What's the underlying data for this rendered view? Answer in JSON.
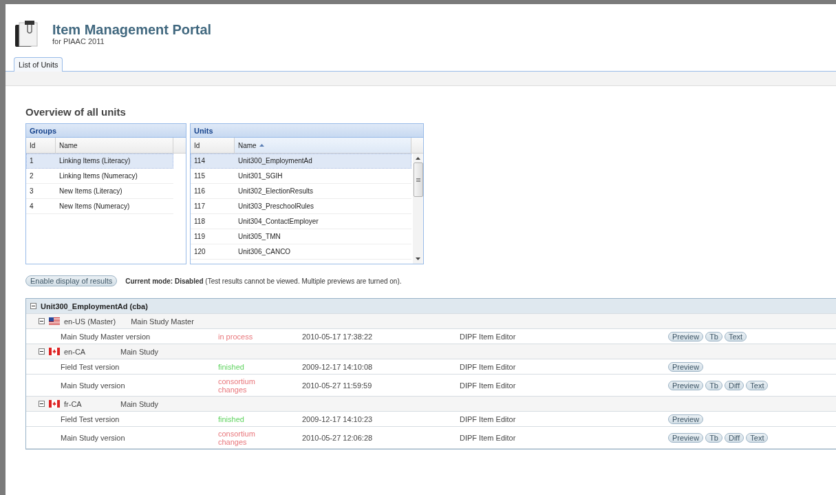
{
  "header": {
    "title": "Item Management Portal",
    "subtitle": "for PIAAC 2011"
  },
  "tabs": [
    {
      "label": "List of Units",
      "selected": true
    }
  ],
  "heading": "Overview of all units",
  "groups": {
    "title": "Groups",
    "columns": [
      "Id",
      "Name"
    ],
    "rows": [
      {
        "id": "1",
        "name": "Linking Items (Literacy)",
        "selected": true
      },
      {
        "id": "2",
        "name": "Linking Items (Numeracy)",
        "selected": false
      },
      {
        "id": "3",
        "name": "New Items (Literacy)",
        "selected": false
      },
      {
        "id": "4",
        "name": "New Items (Numeracy)",
        "selected": false
      }
    ]
  },
  "units": {
    "title": "Units",
    "columns": [
      {
        "label": "Id",
        "sorted": false
      },
      {
        "label": "Name",
        "sorted": true
      }
    ],
    "rows": [
      {
        "id": "114",
        "name": "Unit300_EmploymentAd",
        "selected": true
      },
      {
        "id": "115",
        "name": "Unit301_SGIH",
        "selected": false
      },
      {
        "id": "116",
        "name": "Unit302_ElectionResults",
        "selected": false
      },
      {
        "id": "117",
        "name": "Unit303_PreschoolRules",
        "selected": false
      },
      {
        "id": "118",
        "name": "Unit304_ContactEmployer",
        "selected": false
      },
      {
        "id": "119",
        "name": "Unit305_TMN",
        "selected": false
      },
      {
        "id": "120",
        "name": "Unit306_CANCO",
        "selected": false
      }
    ]
  },
  "mode_bar": {
    "button": "Enable display of results",
    "text": "**Current mode: Disabled** (Test results cannot be viewed. Multiple previews are turned on)."
  },
  "results": {
    "title": "Unit300_EmploymentAd (cba)",
    "expanded": true,
    "locales": [
      {
        "kind": "us",
        "locale": "en-US (Master)",
        "study": "Main Study Master",
        "expanded": true,
        "versions": [
          {
            "name": "Main Study Master version",
            "status": "in process",
            "color": "#e8757a",
            "date": "2010-05-17 17:38:22",
            "editor": "DIPF Item Editor",
            "actions": [
              "Preview",
              "Tb",
              "Text"
            ]
          }
        ]
      },
      {
        "kind": "ca",
        "locale": "en-CA",
        "study": "Main Study",
        "expanded": true,
        "versions": [
          {
            "name": "Field Test version",
            "status": "finished",
            "color": "#5fd35f",
            "date": "2009-12-17 14:10:08",
            "editor": "DIPF Item Editor",
            "actions": [
              "Preview"
            ]
          },
          {
            "name": "Main Study version",
            "status": "consortium changes",
            "color": "#e8757a",
            "date": "2010-05-27 11:59:59",
            "editor": "DIPF Item Editor",
            "actions": [
              "Preview",
              "Tb",
              "Diff",
              "Text"
            ]
          }
        ]
      },
      {
        "kind": "ca",
        "locale": "fr-CA",
        "study": "Main Study",
        "expanded": true,
        "versions": [
          {
            "name": "Field Test version",
            "status": "finished",
            "color": "#5fd35f",
            "date": "2009-12-17 14:10:23",
            "editor": "DIPF Item Editor",
            "actions": [
              "Preview"
            ]
          },
          {
            "name": "Main Study version",
            "status": "consortium changes",
            "color": "#e8757a",
            "date": "2010-05-27 12:06:28",
            "editor": "DIPF Item Editor",
            "actions": [
              "Preview",
              "Tb",
              "Diff",
              "Text"
            ]
          }
        ]
      }
    ]
  }
}
